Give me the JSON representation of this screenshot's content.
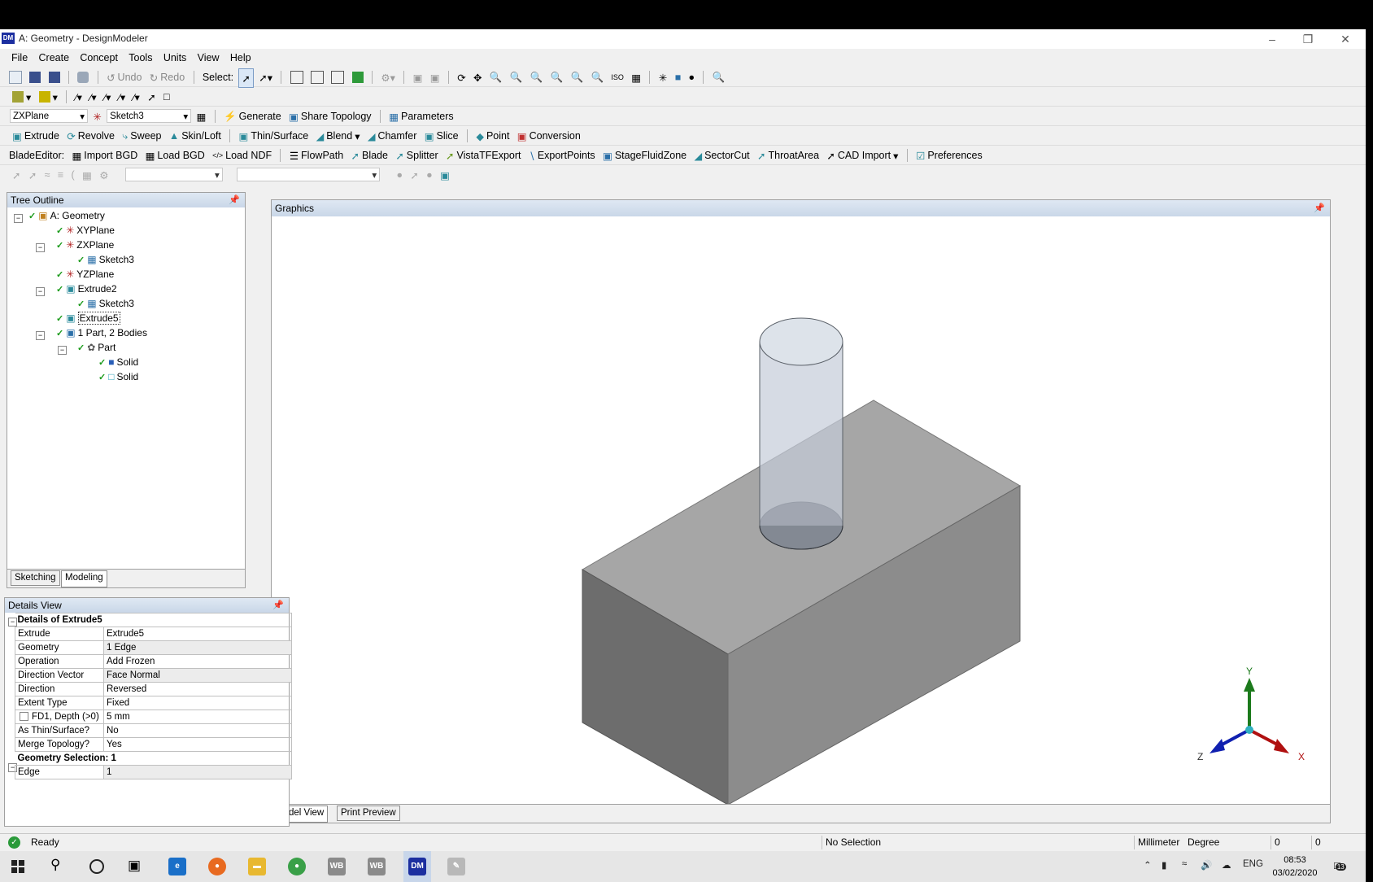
{
  "window": {
    "title": "A: Geometry - DesignModeler",
    "app_icon": "DM"
  },
  "menu": [
    "File",
    "Create",
    "Concept",
    "Tools",
    "Units",
    "View",
    "Help"
  ],
  "toolbar1": {
    "undo": "Undo",
    "redo": "Redo",
    "select_label": "Select:"
  },
  "toolbar3": {
    "plane": "ZXPlane",
    "sketch": "Sketch3",
    "generate": "Generate",
    "share_topology": "Share Topology",
    "parameters": "Parameters"
  },
  "toolbar4": [
    "Extrude",
    "Revolve",
    "Sweep",
    "Skin/Loft",
    "Thin/Surface",
    "Blend",
    "Chamfer",
    "Slice",
    "Point",
    "Conversion"
  ],
  "toolbar5": {
    "label": "BladeEditor:",
    "items": [
      "Import BGD",
      "Load BGD",
      "Load NDF",
      "FlowPath",
      "Blade",
      "Splitter",
      "VistaTFExport",
      "ExportPoints",
      "StageFluidZone",
      "SectorCut",
      "ThroatArea",
      "CAD Import",
      "Preferences"
    ]
  },
  "tree": {
    "header": "Tree Outline",
    "nodes": [
      "A: Geometry",
      "XYPlane",
      "ZXPlane",
      "Sketch3",
      "YZPlane",
      "Extrude2",
      "Sketch3",
      "Extrude5",
      "1 Part, 2 Bodies",
      "Part",
      "Solid",
      "Solid"
    ],
    "tabs": [
      "Sketching",
      "Modeling"
    ]
  },
  "graphics": {
    "header": "Graphics",
    "tabs": [
      "Model View",
      "Print Preview"
    ],
    "axes": {
      "x": "X",
      "y": "Y",
      "z": "Z"
    }
  },
  "details": {
    "header": "Details View",
    "group1": "Details of Extrude5",
    "rows": [
      {
        "k": "Extrude",
        "v": "Extrude5"
      },
      {
        "k": "Geometry",
        "v": "1 Edge"
      },
      {
        "k": "Operation",
        "v": "Add Frozen"
      },
      {
        "k": "Direction Vector",
        "v": "Face Normal"
      },
      {
        "k": "Direction",
        "v": "Reversed"
      },
      {
        "k": "Extent Type",
        "v": "Fixed"
      },
      {
        "k": "FD1,  Depth (>0)",
        "v": "5 mm"
      },
      {
        "k": "As Thin/Surface?",
        "v": "No"
      },
      {
        "k": "Merge Topology?",
        "v": "Yes"
      }
    ],
    "group2": "Geometry Selection: 1",
    "rows2": [
      {
        "k": "Edge",
        "v": "1"
      }
    ]
  },
  "status": {
    "ready": "Ready",
    "selection": "No Selection",
    "units": "Millimeter",
    "angle": "Degree",
    "c1": "0",
    "c2": "0"
  },
  "taskbar": {
    "lang": "ENG",
    "time": "08:53",
    "date": "03/02/2020",
    "notif": "13"
  }
}
